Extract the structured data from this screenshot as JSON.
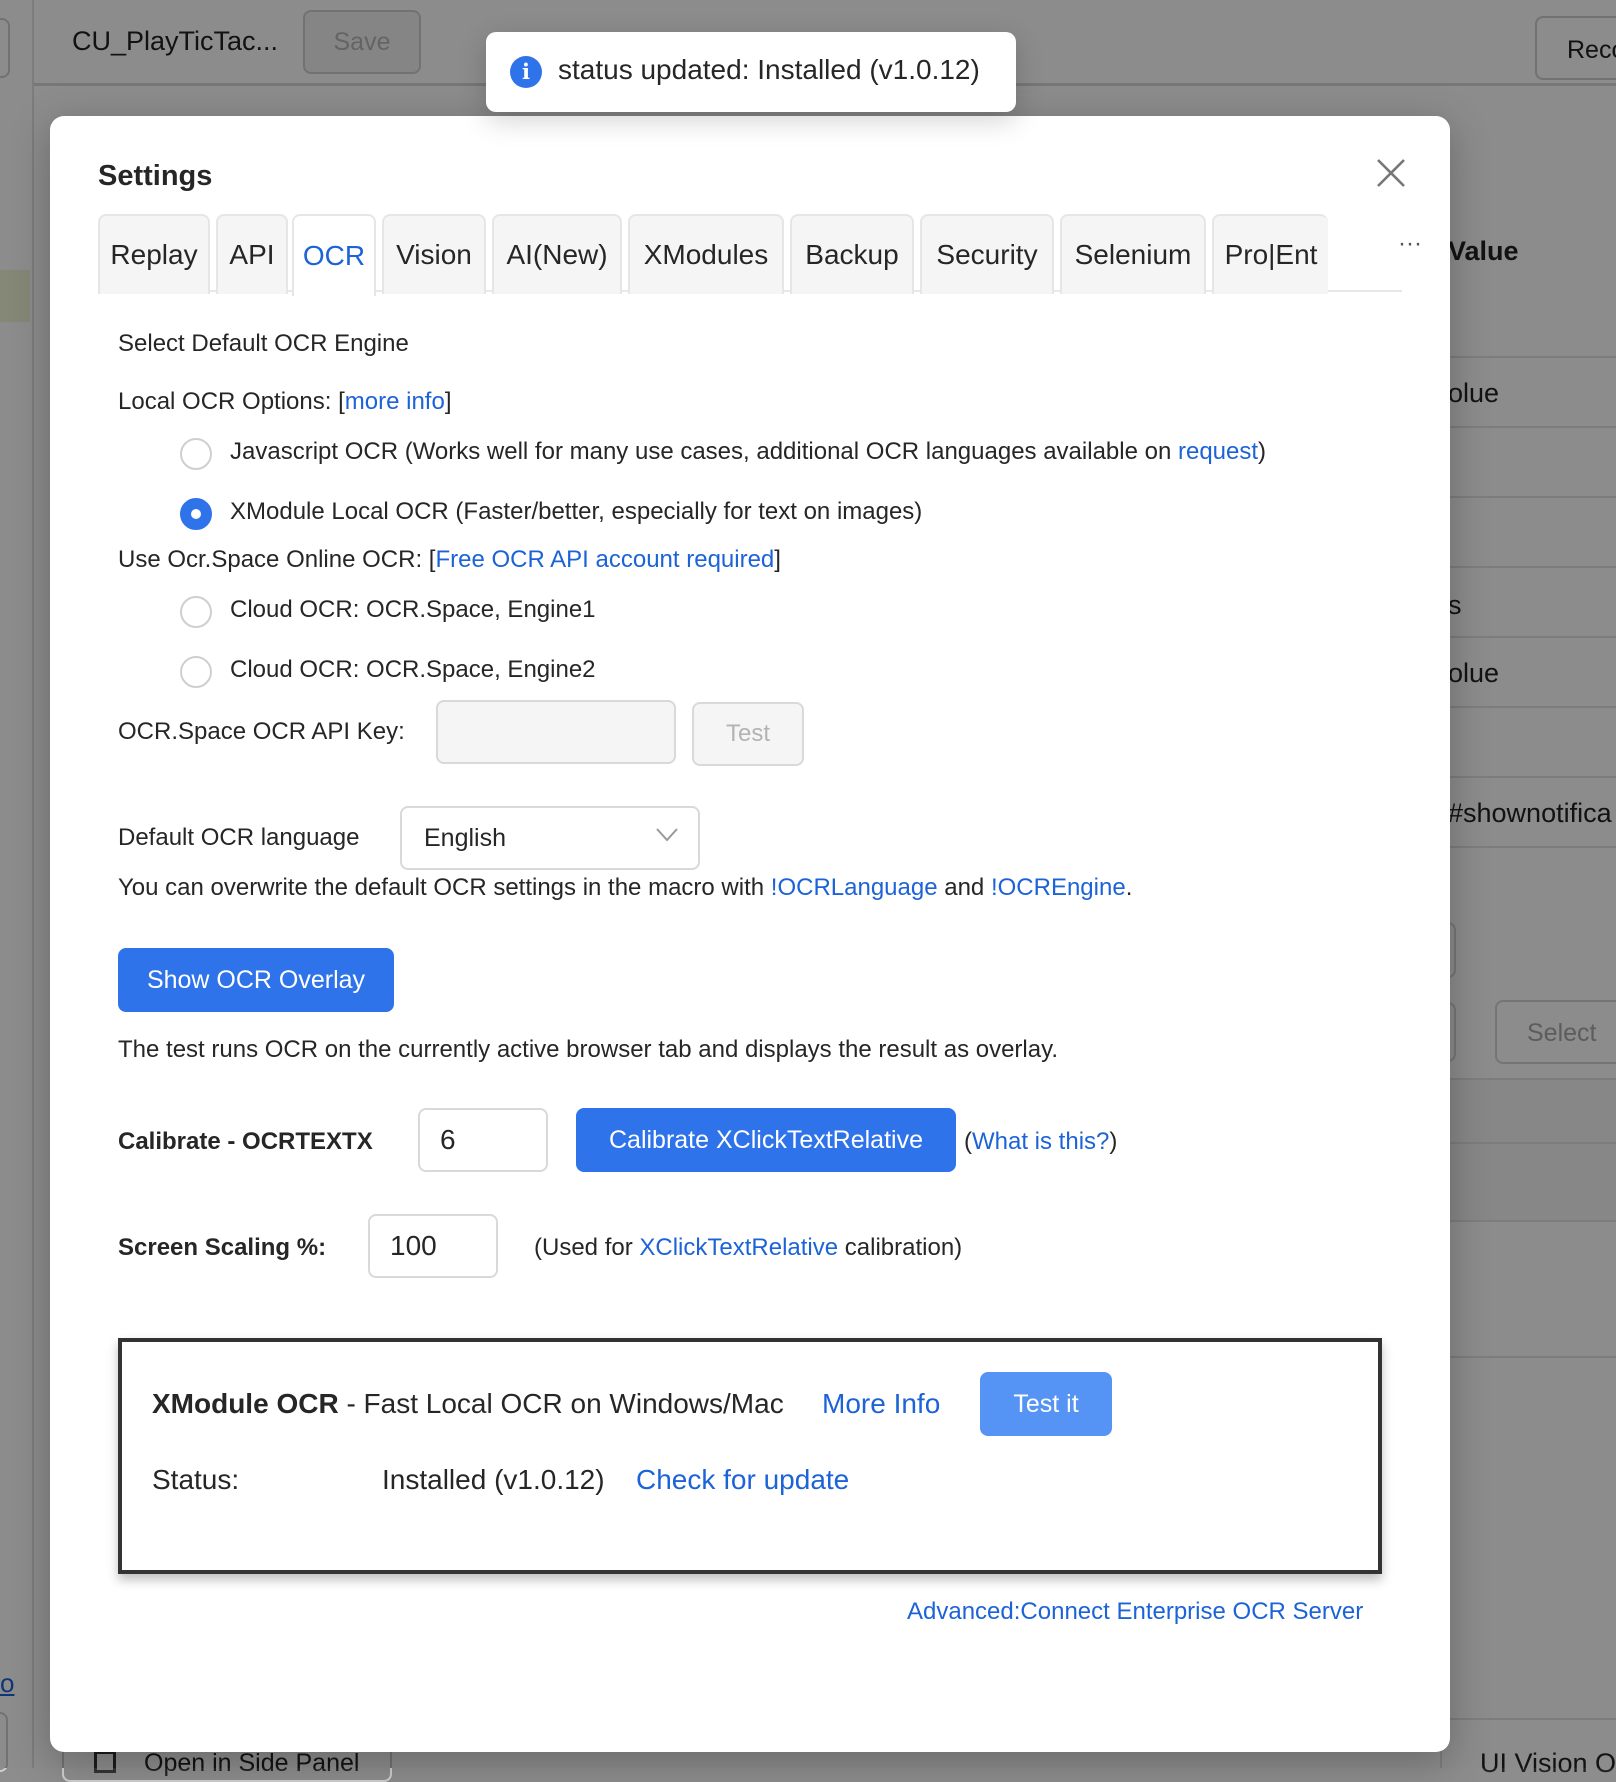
{
  "background": {
    "macro_title": "CU_PlayTicTac...",
    "save_label": "Save",
    "record_label": "Reco",
    "right_column": [
      "Value",
      "olue",
      "s",
      "olue",
      "#shownotifica",
      "Select"
    ],
    "left_link": "o",
    "side_panel_label": "Open in Side Panel",
    "bottom_right_partial": "UI Vision O"
  },
  "toast": {
    "icon": "info-icon",
    "message": "status updated: Installed (v1.0.12)"
  },
  "settings": {
    "title": "Settings",
    "tabs": [
      "Replay",
      "API",
      "OCR",
      "Vision",
      "AI(New)",
      "XModules",
      "Backup",
      "Security",
      "Selenium",
      "Pro|Ent"
    ],
    "active_tab": "OCR",
    "more_tabs": "···",
    "select_engine_label": "Select Default OCR Engine",
    "local_options_prefix": "Local OCR Options: [",
    "local_options_link": "more info",
    "local_options_suffix": "]",
    "radio_js_text": "Javascript OCR (Works well for many use cases, additional OCR languages available on ",
    "radio_js_link": "request",
    "radio_js_suffix": ")",
    "radio_xmodule_text": "XModule Local OCR (Faster/better, especially for text on images)",
    "online_prefix": "Use Ocr.Space Online OCR: [",
    "online_link": "Free OCR API account required",
    "online_suffix": "]",
    "radio_cloud1": "Cloud OCR: OCR.Space, Engine1",
    "radio_cloud2": "Cloud OCR: OCR.Space, Engine2",
    "selected_engine": "XModule Local OCR",
    "api_key_label": "OCR.Space OCR API Key:",
    "api_key_value": "",
    "test_button": "Test",
    "language_label": "Default OCR language",
    "language_value": "English",
    "overwrite_prefix": "You can overwrite the default OCR settings in the macro with ",
    "overwrite_link1": "!OCRLanguage",
    "overwrite_and": " and ",
    "overwrite_link2": "!OCREngine",
    "overwrite_suffix": ".",
    "show_overlay_button": "Show OCR Overlay",
    "overlay_desc": "The test runs OCR on the currently active browser tab and displays the result as overlay.",
    "calibrate_label": "Calibrate - OCRTEXTX",
    "calibrate_value": "6",
    "calibrate_button": "Calibrate XClickTextRelative",
    "what_prefix": "(",
    "what_link": "What is this?",
    "what_suffix": ")",
    "scaling_label": "Screen Scaling %:",
    "scaling_value": "100",
    "scaling_note_prefix": "(Used for ",
    "scaling_note_link": "XClickTextRelative",
    "scaling_note_suffix": " calibration)",
    "xmodule_box": {
      "title_bold": "XModule OCR",
      "title_rest": " - Fast Local OCR on Windows/Mac",
      "more_info": "More Info",
      "test_it": "Test it",
      "status_label": "Status:",
      "status_value": "Installed (v1.0.12)",
      "check_update": "Check for update"
    },
    "advanced_link": "Advanced:Connect Enterprise OCR Server"
  },
  "colors": {
    "accent": "#2f73ea",
    "link": "#1d63d8",
    "overlay": "rgba(0,0,0,0.45)"
  }
}
